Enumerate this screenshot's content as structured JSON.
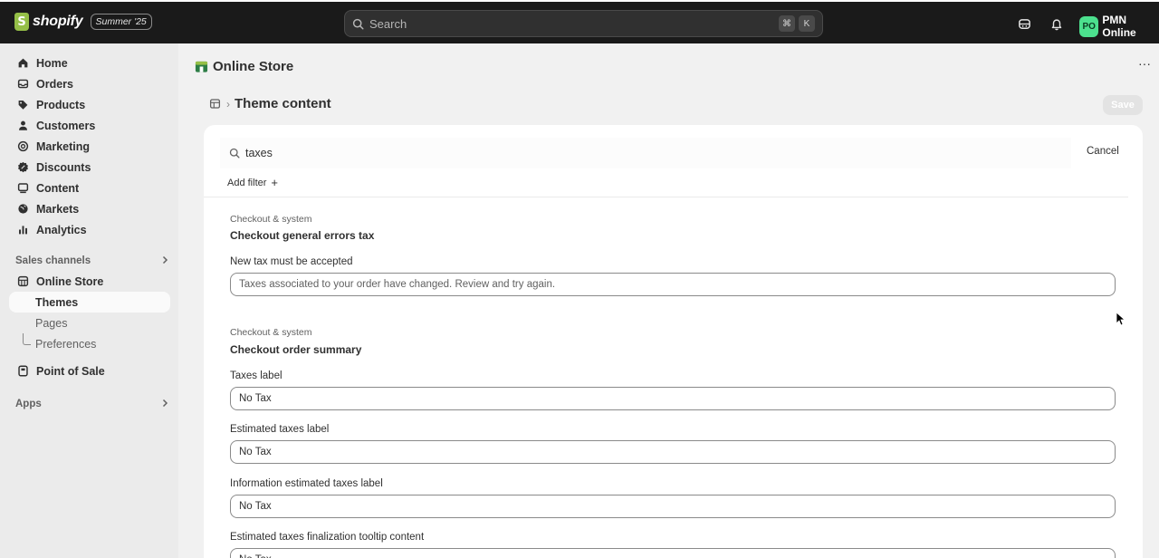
{
  "topbar": {
    "brand_name": "shopify",
    "brand_badge": "Summer '25",
    "search_placeholder": "Search",
    "shortcut_keys": [
      "⌘",
      "K"
    ],
    "avatar_initials": "PO",
    "account_name": "PMN Online"
  },
  "sidebar": {
    "items": [
      {
        "label": "Home",
        "icon": "home-icon"
      },
      {
        "label": "Orders",
        "icon": "inbox-icon"
      },
      {
        "label": "Products",
        "icon": "tag-icon"
      },
      {
        "label": "Customers",
        "icon": "person-icon"
      },
      {
        "label": "Marketing",
        "icon": "target-icon"
      },
      {
        "label": "Discounts",
        "icon": "discount-icon"
      },
      {
        "label": "Content",
        "icon": "content-icon"
      },
      {
        "label": "Markets",
        "icon": "globe-icon"
      },
      {
        "label": "Analytics",
        "icon": "bar-chart-icon"
      }
    ],
    "sales_channels_heading": "Sales channels",
    "online_store_label": "Online Store",
    "sub_items": [
      "Themes",
      "Pages",
      "Preferences"
    ],
    "point_of_sale_label": "Point of Sale",
    "apps_heading": "Apps"
  },
  "main": {
    "page_title": "Online Store",
    "breadcrumb_title": "Theme content",
    "save_label": "Save",
    "search_value": "taxes",
    "cancel_label": "Cancel",
    "add_filter_label": "Add filter",
    "groups": [
      {
        "category": "Checkout & system",
        "title": "Checkout general errors tax",
        "fields": [
          {
            "label": "New tax must be accepted",
            "value": "Taxes associated to your order have changed. Review and try again."
          }
        ]
      },
      {
        "category": "Checkout & system",
        "title": "Checkout order summary",
        "fields": [
          {
            "label": "Taxes label",
            "value": "No Tax"
          },
          {
            "label": "Estimated taxes label",
            "value": "No Tax"
          },
          {
            "label": "Information estimated taxes label",
            "value": "No Tax"
          },
          {
            "label": "Estimated taxes finalization tooltip content",
            "value": "No Tax"
          }
        ]
      }
    ]
  },
  "colors": {
    "topbar_bg": "#1a1a1a",
    "brand_green": "#95bf47",
    "avatar_green": "#4ce08e",
    "sidebar_bg": "#ebebeb",
    "page_bg": "#f1f1f1"
  }
}
